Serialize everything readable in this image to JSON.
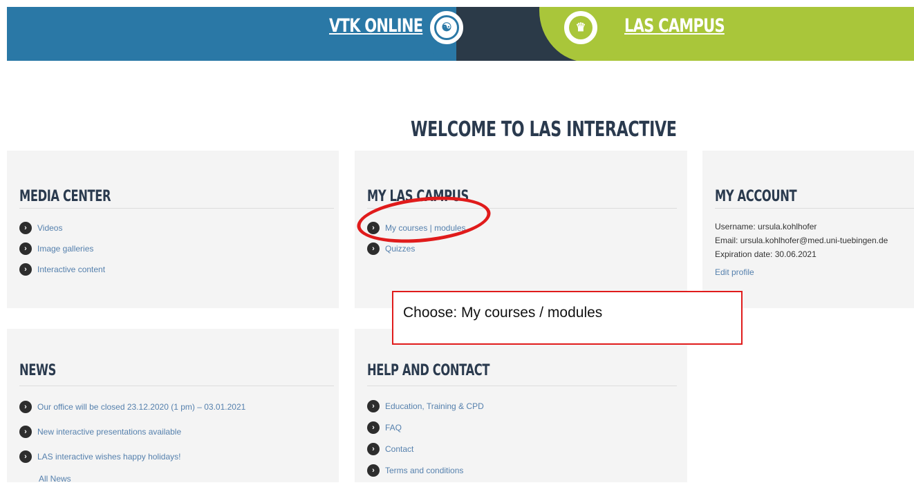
{
  "header": {
    "vtk_online": "VTK ONLINE",
    "vtk_badge_glyph": "☯",
    "las_campus": "LAS CAMPUS",
    "las_badge_glyph": "♛",
    "colors": {
      "blue": "#2a78a6",
      "dark": "#2b3a48",
      "green": "#a9c63a"
    }
  },
  "page_title": "WELCOME TO LAS INTERACTIVE",
  "media_center": {
    "title": "MEDIA CENTER",
    "items": [
      "Videos",
      "Image galleries",
      "Interactive content"
    ]
  },
  "my_las_campus": {
    "title": "MY LAS CAMPUS",
    "items": [
      "My courses | modules",
      "Quizzes"
    ]
  },
  "my_account": {
    "title": "MY ACCOUNT",
    "username": "Username: ursula.kohlhofer",
    "email": "Email: ursula.kohlhofer@med.uni-tuebingen.de",
    "expiration": "Expiration date: 30.06.2021",
    "edit_profile": "Edit profile"
  },
  "news": {
    "title": "NEWS",
    "items": [
      "Our office will be closed 23.12.2020 (1 pm) – 03.01.2021",
      "New interactive presentations available",
      "LAS interactive wishes happy holidays!"
    ],
    "all_news": "All News"
  },
  "help_contact": {
    "title": "HELP AND CONTACT",
    "items": [
      "Education, Training & CPD",
      "FAQ",
      "Contact",
      "Terms and conditions"
    ]
  },
  "annotation": {
    "callout_text": "Choose: My courses / modules",
    "color": "#e01b1b"
  },
  "icons": {
    "list_arrow": "›"
  }
}
